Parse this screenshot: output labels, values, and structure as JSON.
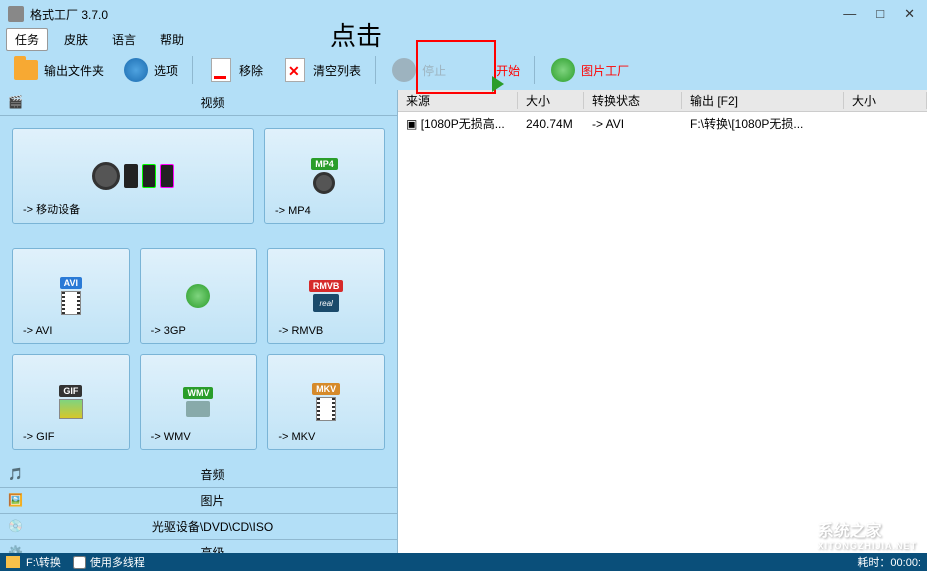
{
  "window": {
    "title": "格式工厂 3.7.0"
  },
  "annotation": "点击",
  "menu": {
    "items": [
      "任务",
      "皮肤",
      "语言",
      "帮助"
    ],
    "active_index": 0
  },
  "toolbar": {
    "output_folder": "输出文件夹",
    "options": "选项",
    "remove": "移除",
    "clear_list": "清空列表",
    "stop": "停止",
    "start": "开始",
    "image_factory": "图片工厂"
  },
  "categories": {
    "video": "视频",
    "audio": "音频",
    "image": "图片",
    "disc": "光驱设备\\DVD\\CD\\ISO",
    "advanced": "高级"
  },
  "formats": {
    "mobile": "-> 移动设备",
    "mp4": "-> MP4",
    "avi": "-> AVI",
    "3gp": "-> 3GP",
    "rmvb": "-> RMVB",
    "gif": "-> GIF",
    "wmv": "-> WMV",
    "mkv": "-> MKV"
  },
  "badges": {
    "mp4": "MP4",
    "avi": "AVI",
    "rmvb": "RMVB",
    "gif": "GIF",
    "wmv": "WMV",
    "mkv": "MKV"
  },
  "table": {
    "headers": {
      "source": "来源",
      "size": "大小",
      "status": "转换状态",
      "output": "输出 [F2]",
      "size2": "大小"
    },
    "rows": [
      {
        "source": "[1080P无损高...",
        "size": "240.74M",
        "status": "-> AVI",
        "output": "F:\\转换\\[1080P无损...",
        "size2": ""
      }
    ]
  },
  "statusbar": {
    "path": "F:\\转换",
    "multithread": "使用多线程",
    "elapsed_label": "耗时：",
    "elapsed_value": "00:00:"
  },
  "watermark": {
    "text": "系统之家",
    "url": "XITONGZHIJIA.NET"
  }
}
